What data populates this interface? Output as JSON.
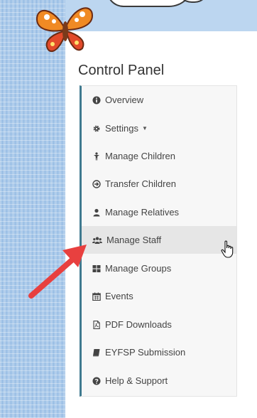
{
  "page": {
    "title": "Control Panel"
  },
  "menu": {
    "items": [
      {
        "label": "Overview",
        "icon": "info-circle-icon"
      },
      {
        "label": "Settings",
        "icon": "gear-icon",
        "dropdown": true
      },
      {
        "label": "Manage Children",
        "icon": "child-icon"
      },
      {
        "label": "Transfer Children",
        "icon": "arrow-circle-icon"
      },
      {
        "label": "Manage Relatives",
        "icon": "user-icon"
      },
      {
        "label": "Manage Staff",
        "icon": "users-icon",
        "active": true
      },
      {
        "label": "Manage Groups",
        "icon": "grid-icon"
      },
      {
        "label": "Events",
        "icon": "calendar-icon"
      },
      {
        "label": "PDF Downloads",
        "icon": "pdf-file-icon"
      },
      {
        "label": "EYFSP Submission",
        "icon": "book-icon"
      },
      {
        "label": "Help & Support",
        "icon": "question-circle-icon"
      }
    ]
  },
  "colors": {
    "accent_border": "#3f7a8f",
    "annotation_arrow": "#e8403f",
    "background": "#a9c9ea"
  }
}
